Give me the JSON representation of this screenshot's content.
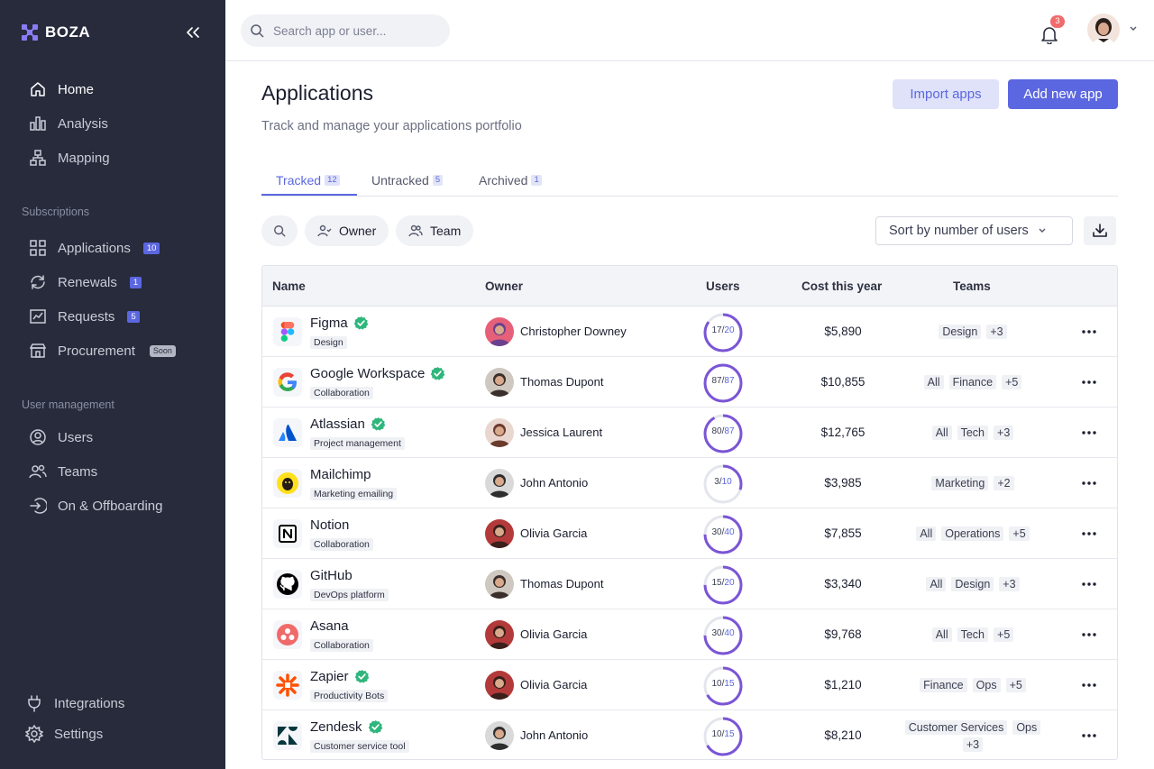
{
  "brand": {
    "name": "BOZA"
  },
  "sidebar": {
    "main_items": [
      {
        "label": "Home",
        "icon": "home-icon"
      },
      {
        "label": "Analysis",
        "icon": "bar-chart-icon"
      },
      {
        "label": "Mapping",
        "icon": "sitemap-icon"
      }
    ],
    "subscriptions_title": "Subscriptions",
    "subscriptions": [
      {
        "label": "Applications",
        "icon": "grid-icon",
        "badge": "10"
      },
      {
        "label": "Renewals",
        "icon": "refresh-icon",
        "badge": "1"
      },
      {
        "label": "Requests",
        "icon": "chart-box-icon",
        "badge": "5"
      },
      {
        "label": "Procurement",
        "icon": "store-icon",
        "badge": "Soon"
      }
    ],
    "user_mgmt_title": "User management",
    "user_mgmt": [
      {
        "label": "Users",
        "icon": "user-circle-icon"
      },
      {
        "label": "Teams",
        "icon": "users-icon"
      },
      {
        "label": "On & Offboarding",
        "icon": "login-icon"
      }
    ],
    "bottom": [
      {
        "label": "Integrations",
        "icon": "plug-icon"
      },
      {
        "label": "Settings",
        "icon": "gear-icon"
      }
    ]
  },
  "topbar": {
    "search_placeholder": "Search app or user...",
    "notification_count": "3"
  },
  "page": {
    "title": "Applications",
    "subtitle": "Track and manage your applications portfolio",
    "import_label": "Import apps",
    "add_label": "Add new app"
  },
  "tabs": [
    {
      "label": "Tracked",
      "count": "12"
    },
    {
      "label": "Untracked",
      "count": "5"
    },
    {
      "label": "Archived",
      "count": "1"
    }
  ],
  "filters": {
    "owner_label": "Owner",
    "team_label": "Team",
    "sort_label": "Sort by number of users"
  },
  "table": {
    "headers": {
      "name": "Name",
      "owner": "Owner",
      "users": "Users",
      "cost": "Cost this year",
      "teams": "Teams"
    },
    "rows": [
      {
        "app": "Figma",
        "verified": true,
        "category": "Design",
        "logo": "figma-logo-icon",
        "owner": "Christopher Downey",
        "users": 17,
        "total": 20,
        "cost": "$5,890",
        "teams": [
          "Design",
          "+3"
        ]
      },
      {
        "app": "Google Workspace",
        "verified": true,
        "category": "Collaboration",
        "logo": "google-logo-icon",
        "owner": "Thomas Dupont",
        "users": 87,
        "total": 87,
        "cost": "$10,855",
        "teams": [
          "All",
          "Finance",
          "+5"
        ]
      },
      {
        "app": "Atlassian",
        "verified": true,
        "category": "Project management",
        "logo": "atlassian-logo-icon",
        "owner": "Jessica Laurent",
        "users": 80,
        "total": 87,
        "cost": "$12,765",
        "teams": [
          "All",
          "Tech",
          "+3"
        ]
      },
      {
        "app": "Mailchimp",
        "verified": false,
        "category": "Marketing emailing",
        "logo": "mailchimp-logo-icon",
        "owner": "John Antonio",
        "users": 3,
        "total": 10,
        "cost": "$3,985",
        "teams": [
          "Marketing",
          "+2"
        ]
      },
      {
        "app": "Notion",
        "verified": false,
        "category": "Collaboration",
        "logo": "notion-logo-icon",
        "owner": "Olivia Garcia",
        "users": 30,
        "total": 40,
        "cost": "$7,855",
        "teams": [
          "All",
          "Operations",
          "+5"
        ]
      },
      {
        "app": "GitHub",
        "verified": false,
        "category": "DevOps platform",
        "logo": "github-logo-icon",
        "owner": "Thomas Dupont",
        "users": 15,
        "total": 20,
        "cost": "$3,340",
        "teams": [
          "All",
          "Design",
          "+3"
        ]
      },
      {
        "app": "Asana",
        "verified": false,
        "category": "Collaboration",
        "logo": "asana-logo-icon",
        "owner": "Olivia Garcia",
        "users": 30,
        "total": 40,
        "cost": "$9,768",
        "teams": [
          "All",
          "Tech",
          "+5"
        ]
      },
      {
        "app": "Zapier",
        "verified": true,
        "category": "Productivity Bots",
        "logo": "zapier-logo-icon",
        "owner": "Olivia Garcia",
        "users": 10,
        "total": 15,
        "cost": "$1,210",
        "teams": [
          "Finance",
          "Ops",
          "+5"
        ]
      },
      {
        "app": "Zendesk",
        "verified": true,
        "category": "Customer service tool",
        "logo": "zendesk-logo-icon",
        "owner": "John Antonio",
        "users": 10,
        "total": 15,
        "cost": "$8,210",
        "teams": [
          "Customer Services",
          "Ops",
          "+3"
        ]
      }
    ]
  },
  "colors": {
    "accent": "#5b67e0",
    "sidebar_bg": "#272b3b",
    "verified": "#2fb67c",
    "ring_track": "#e4e6ed"
  }
}
